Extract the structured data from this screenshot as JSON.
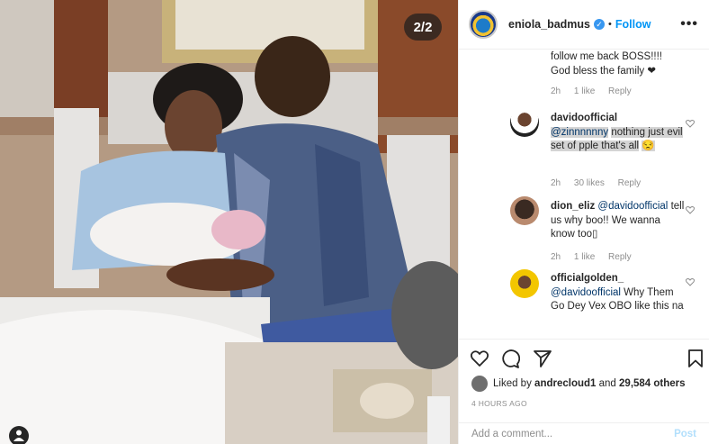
{
  "photo": {
    "counter": "2/2",
    "description_icon": "person-tag-icon"
  },
  "header": {
    "username": "eniola_badmus",
    "separator": "•",
    "follow_label": "Follow",
    "more_label": "•••"
  },
  "comments": [
    {
      "text_line1": "follow me back BOSS!!!!",
      "text_line2": "God bless the family ❤︎",
      "time": "2h",
      "likes": "1 like",
      "reply": "Reply"
    },
    {
      "username": "davidoofficial",
      "mention": "@zinnnnnny",
      "text": "nothing just evil set of pple that's all",
      "emoji": "😒",
      "time": "2h",
      "likes": "30 likes",
      "reply": "Reply"
    },
    {
      "username": "dion_eliz",
      "mention": "@davidoofficial",
      "text": "tell us why boo!! We wanna know too▯",
      "time": "2h",
      "likes": "1 like",
      "reply": "Reply"
    },
    {
      "username": "officialgolden_",
      "mention": "@davidoofficial",
      "text": "Why Them Go Dey Vex OBO like this na"
    }
  ],
  "likes": {
    "prefix": "Liked by",
    "user": "andrecloud1",
    "and": "and",
    "count": "29,584 others"
  },
  "timestamp": "4 HOURS AGO",
  "add_comment": {
    "placeholder": "Add a comment...",
    "post_label": "Post"
  },
  "colors": {
    "link": "#0095f6",
    "text": "#262626",
    "muted": "#8e8e8e",
    "post_disabled": "#b2dffc"
  }
}
